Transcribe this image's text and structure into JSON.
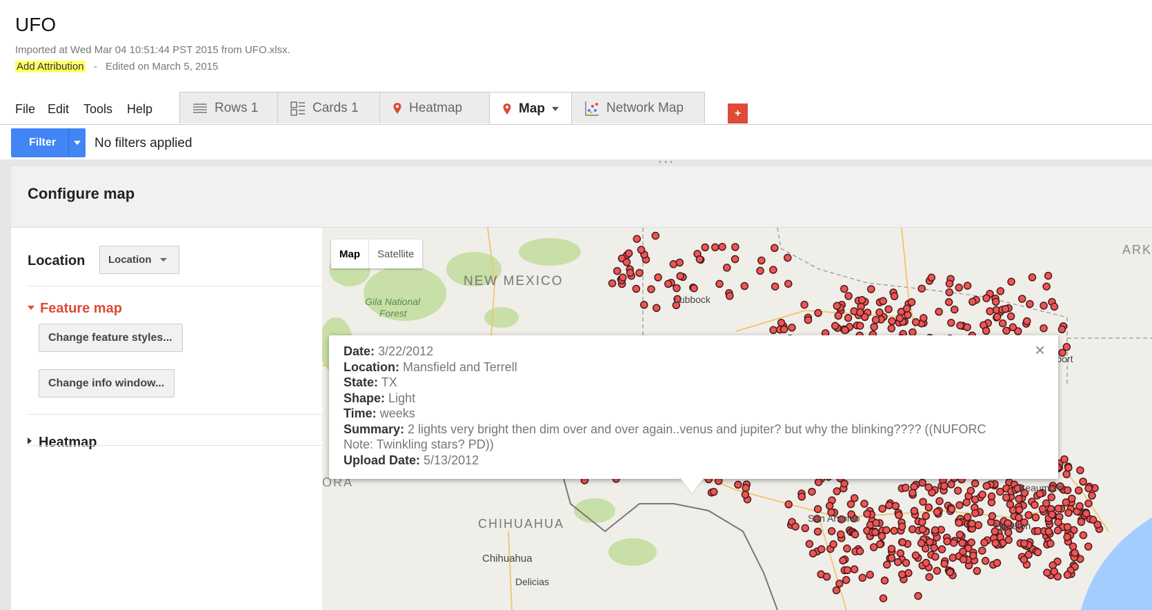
{
  "header": {
    "title": "UFO",
    "imported": "Imported at Wed Mar 04 10:51:44 PST 2015 from UFO.xlsx.",
    "add_attribution": "Add Attribution",
    "separator": "-",
    "edited": "Edited on March 5, 2015"
  },
  "menu": {
    "file": "File",
    "edit": "Edit",
    "tools": "Tools",
    "help": "Help"
  },
  "tabs": [
    {
      "label": "Rows 1",
      "icon": "rows-icon"
    },
    {
      "label": "Cards 1",
      "icon": "cards-icon"
    },
    {
      "label": "Heatmap",
      "icon": "map-pin-icon"
    },
    {
      "label": "Map",
      "icon": "map-pin-icon",
      "active": true
    },
    {
      "label": "Network Map",
      "icon": "network-chart-icon"
    }
  ],
  "add_tab": "+",
  "filter": {
    "button": "Filter",
    "status": "No filters applied"
  },
  "configure": {
    "title": "Configure map",
    "location_label": "Location",
    "location_select": "Location",
    "feature_map": "Feature map",
    "change_styles": "Change feature styles...",
    "change_info": "Change info window...",
    "heatmap": "Heatmap"
  },
  "map": {
    "toggle_map": "Map",
    "toggle_satellite": "Satellite",
    "labels": {
      "new_mexico": "NEW MEXICO",
      "gila": "Gila National",
      "forest": "Forest",
      "lubbock": "Lubbock",
      "shreveport": "Shreveport",
      "ark": "ARK",
      "sonora": "ORA",
      "chihuahua_state": "CHIHUAHUA",
      "chihuahua_city": "Chihuahua",
      "delicias": "Delicias",
      "san_antonio": "San Antonio",
      "beaumont": "Beaumont",
      "houston": "Houston"
    },
    "colors": {
      "marker": "#ee5555",
      "marker_stroke": "#4a1a1a",
      "water": "#a3ccff",
      "park": "#c8dfa8",
      "land": "#efeee9"
    }
  },
  "info": {
    "date_label": "Date:",
    "date": "3/22/2012",
    "location_label": "Location:",
    "location": "Mansfield and Terrell",
    "state_label": "State:",
    "state": "TX",
    "shape_label": "Shape:",
    "shape": "Light",
    "time_label": "Time:",
    "time": "weeks",
    "summary_label": "Summary:",
    "summary_line1": "2 lights very bright then dim over and over again..venus and jupiter? but why the blinking???? ((NUFORC",
    "summary_line2": "Note: Twinkling stars? PD))",
    "upload_label": "Upload Date:",
    "upload": "5/13/2012",
    "close": "×"
  }
}
